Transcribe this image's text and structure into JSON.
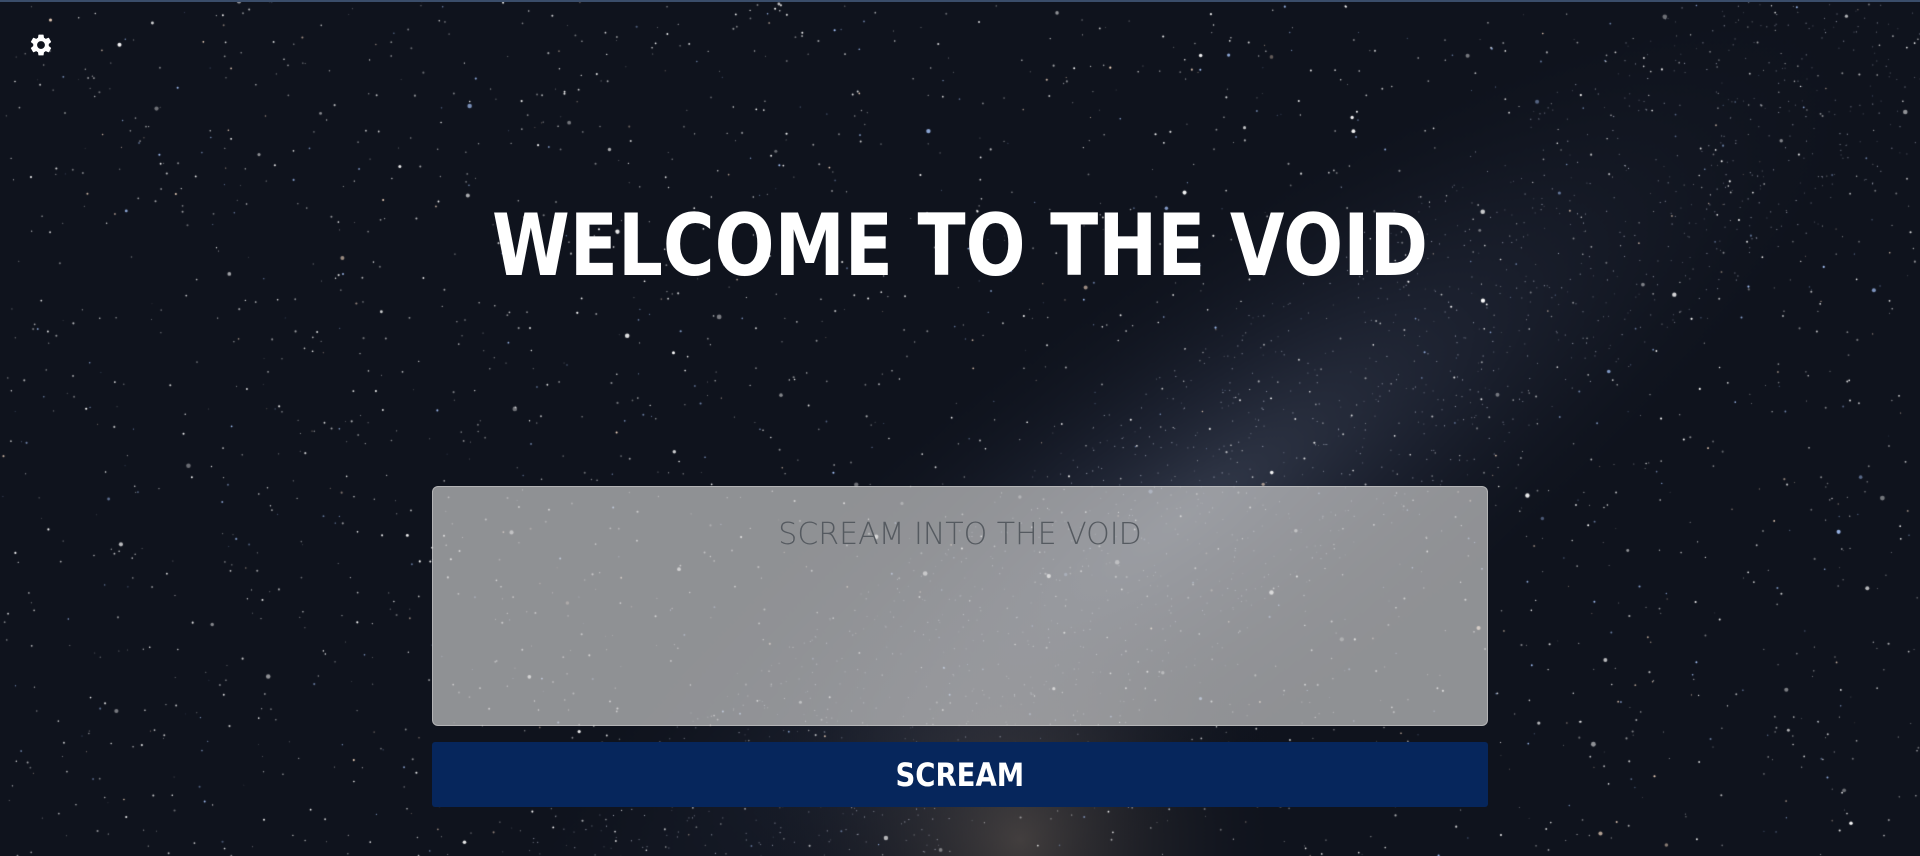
{
  "settings": {
    "icon": "gear-icon"
  },
  "hero": {
    "title": "WELCOME TO THE VOID"
  },
  "scream_form": {
    "input_value": "",
    "input_placeholder": "SCREAM INTO THE VOID",
    "submit_label": "SCREAM"
  },
  "colors": {
    "sky_dark": "#0f131d",
    "milky_way": "#3a4258",
    "button_bg": "#06265c",
    "title_text": "#ffffff"
  }
}
